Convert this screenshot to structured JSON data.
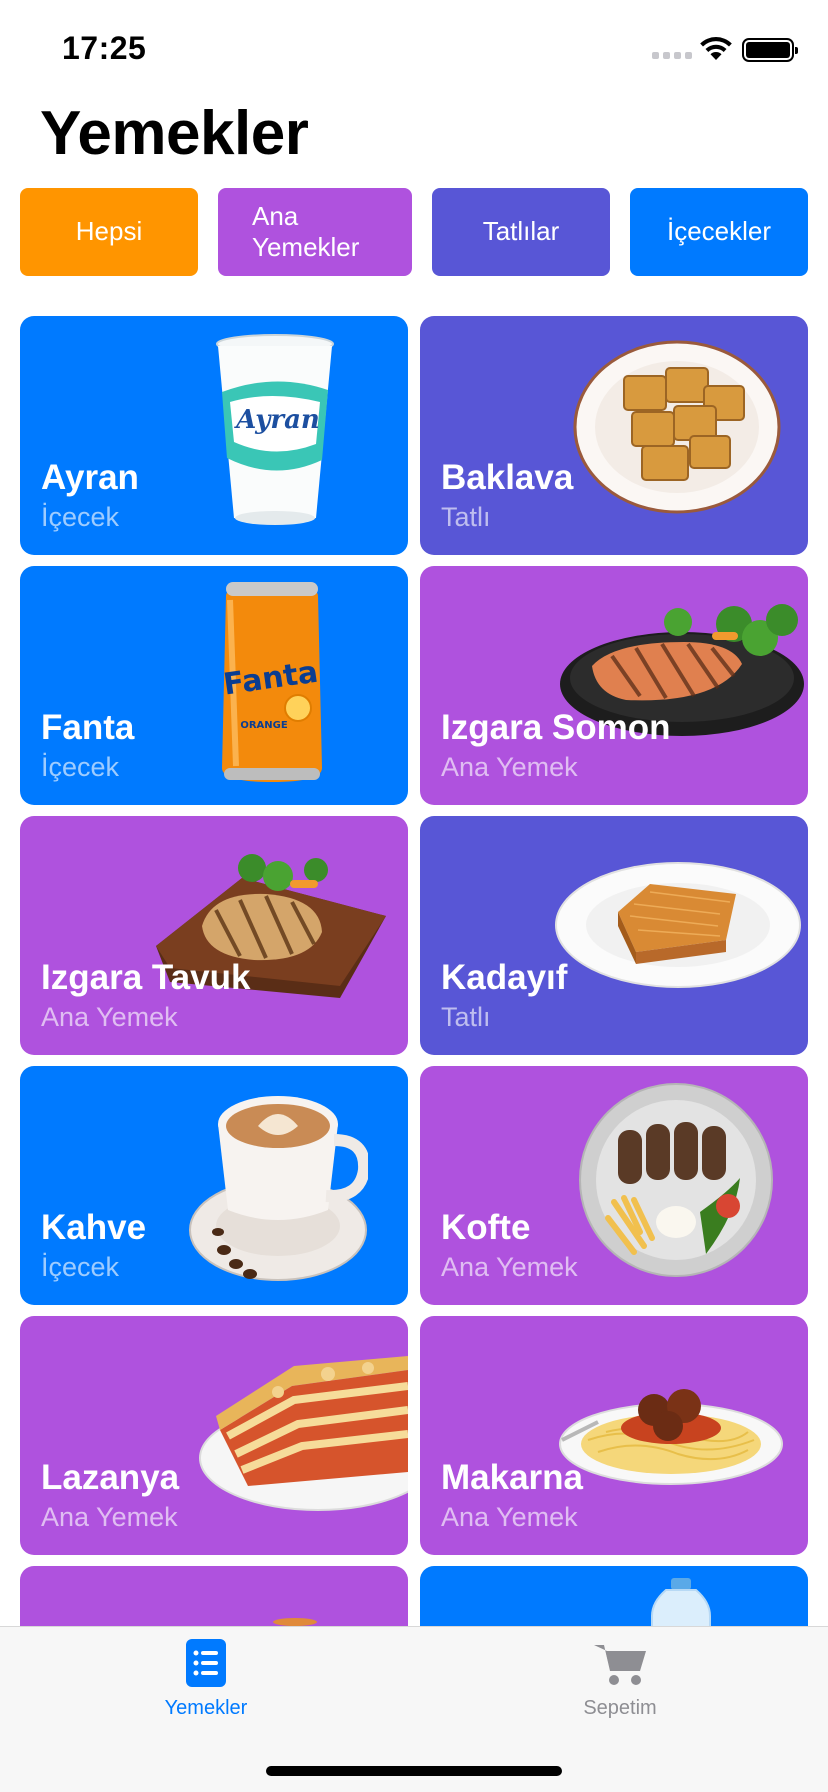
{
  "status_bar": {
    "time": "17:25"
  },
  "page": {
    "title": "Yemekler"
  },
  "filters": [
    {
      "label": "Hepsi",
      "color": "#FF9500"
    },
    {
      "label": "Ana Yemekler",
      "color": "#AF52DE"
    },
    {
      "label": "Tatlılar",
      "color": "#5856D6"
    },
    {
      "label": "İçecekler",
      "color": "#007AFF"
    }
  ],
  "colors": {
    "drink": "#007AFF",
    "main": "#AF52DE",
    "dessert": "#5856D6",
    "tab_active": "#007AFF",
    "tab_inactive": "#8E8E93"
  },
  "items": [
    {
      "name": "Ayran",
      "category": "İçecek",
      "icon": "ayran-cup-icon"
    },
    {
      "name": "Baklava",
      "category": "Tatlı",
      "icon": "baklava-plate-icon"
    },
    {
      "name": "Fanta",
      "category": "İçecek",
      "icon": "fanta-can-icon"
    },
    {
      "name": "Izgara Somon",
      "category": "Ana Yemek",
      "icon": "grilled-salmon-icon"
    },
    {
      "name": "Izgara Tavuk",
      "category": "Ana Yemek",
      "icon": "grilled-chicken-icon"
    },
    {
      "name": "Kadayıf",
      "category": "Tatlı",
      "icon": "kadayif-plate-icon"
    },
    {
      "name": "Kahve",
      "category": "İçecek",
      "icon": "coffee-cup-icon"
    },
    {
      "name": "Kofte",
      "category": "Ana Yemek",
      "icon": "kofte-plate-icon"
    },
    {
      "name": "Lazanya",
      "category": "Ana Yemek",
      "icon": "lasagna-plate-icon"
    },
    {
      "name": "Makarna",
      "category": "Ana Yemek",
      "icon": "pasta-plate-icon"
    }
  ],
  "tab_bar": {
    "tabs": [
      {
        "label": "Yemekler",
        "icon": "list-icon",
        "active": true
      },
      {
        "label": "Sepetim",
        "icon": "cart-icon",
        "active": false
      }
    ]
  }
}
